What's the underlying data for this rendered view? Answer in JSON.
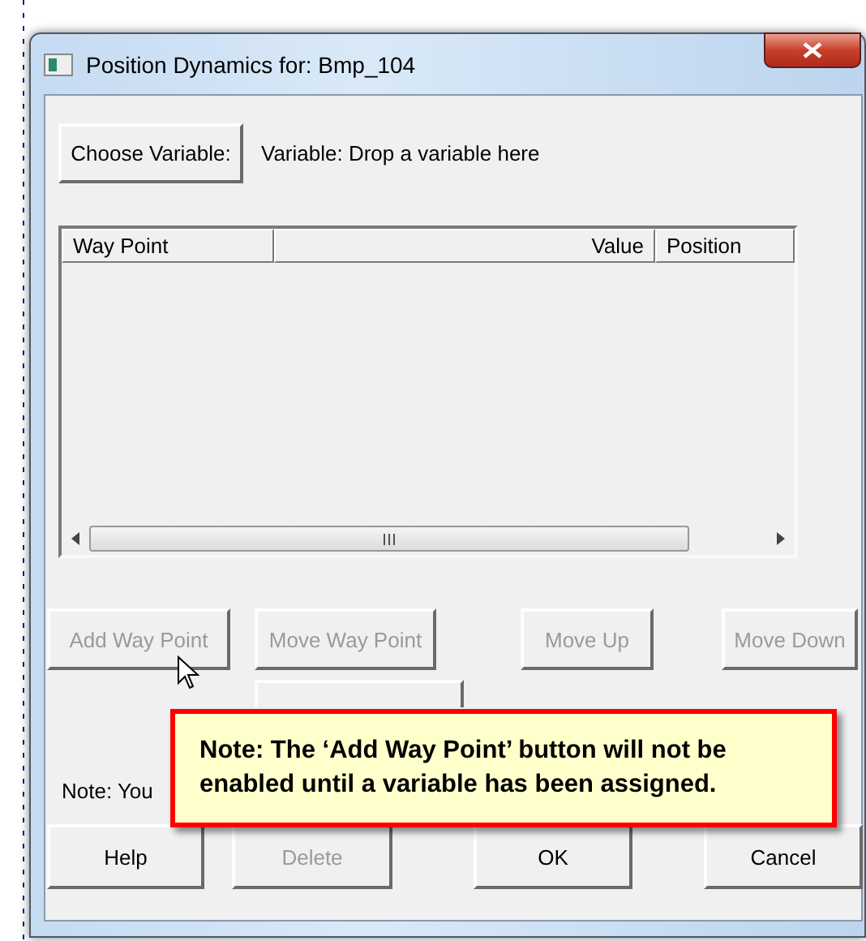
{
  "window": {
    "title": "Position Dynamics for: Bmp_104"
  },
  "choose_button": {
    "label": "Choose Variable:"
  },
  "variable_label": "Variable:  Drop a variable here",
  "table": {
    "columns": [
      "Way Point",
      "Value",
      "Position"
    ]
  },
  "action_buttons": [
    {
      "label": "Add Way Point",
      "disabled": true
    },
    {
      "label": "Move Way Point",
      "disabled": true
    },
    {
      "label": "Move Up",
      "disabled": true
    },
    {
      "label": "Move Down",
      "disabled": true
    }
  ],
  "note": "Note: You",
  "dialog_buttons": [
    {
      "label": "Help",
      "disabled": false
    },
    {
      "label": "Delete",
      "disabled": true
    },
    {
      "label": "OK",
      "disabled": false
    },
    {
      "label": "Cancel",
      "disabled": false
    }
  ],
  "callout": "Note: The ‘Add Way Point’ button will not be enabled until a variable has been assigned."
}
